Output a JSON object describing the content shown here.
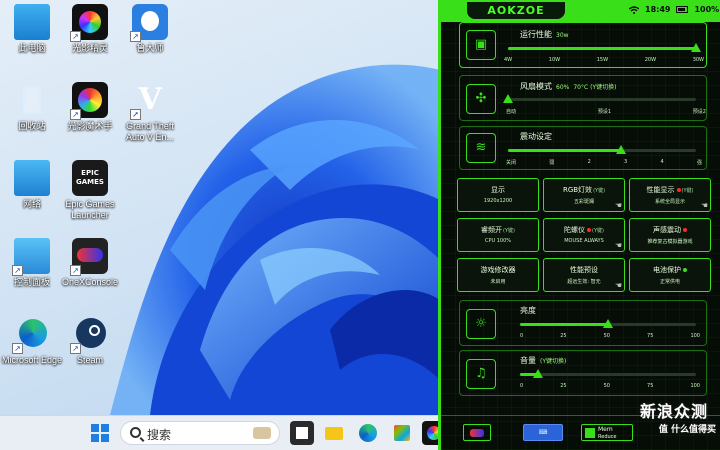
{
  "desktop": {
    "icons": [
      {
        "label": "此电脑"
      },
      {
        "label": "光影精灵"
      },
      {
        "label": "鲁大师"
      },
      {
        "label": "回收站"
      },
      {
        "label": "光影魔术手"
      },
      {
        "label": "Grand Theft Auto V En..."
      },
      {
        "label": "网络"
      },
      {
        "label": "Epic Games Launcher"
      },
      {
        "label": "控制面板"
      },
      {
        "label": "OneXConsole"
      },
      {
        "label": "Microsoft Edge"
      },
      {
        "label": "Steam"
      }
    ],
    "epic_logo_text": "EPIC GAMES"
  },
  "taskbar": {
    "search_placeholder": "搜索"
  },
  "panel": {
    "brand": "AOKZOE",
    "status": {
      "time": "18:49",
      "battery": "100%"
    },
    "performance": {
      "title": "运行性能",
      "value": "30w",
      "level_percent": 100,
      "ticks": [
        "4W",
        "10W",
        "15W",
        "20W",
        "30W"
      ]
    },
    "fan": {
      "title": "风扇模式",
      "value": "60%",
      "sub": "70°C (Y键切换)",
      "level_percent": 0,
      "ticks": [
        "自动",
        "预设1",
        "预设2"
      ]
    },
    "vibration": {
      "title": "震动设定",
      "level_percent": 60,
      "ticks": [
        "关闭",
        "弱",
        "2",
        "3",
        "4",
        "强"
      ]
    },
    "tiles": [
      {
        "title": "显示",
        "hint": "",
        "value": "1920x1200",
        "dot": ""
      },
      {
        "title": "RGB灯效",
        "hint": "(Y键)",
        "value": "五彩斑斓",
        "dot": ""
      },
      {
        "title": "性能显示",
        "hint": "(Y键)",
        "value": "系统全局显示",
        "dot": "#ff2a2a"
      },
      {
        "title": "睿频开",
        "hint": "(Y键)",
        "value": "CPU 100%",
        "dot": ""
      },
      {
        "title": "陀螺仪",
        "hint": "(Y键)",
        "value": "MOUSE ALWAYS",
        "dot": "#ff2a2a"
      },
      {
        "title": "声感震动",
        "hint": "",
        "value": "推荐复古模拟器游戏",
        "dot": "#ff2a2a"
      },
      {
        "title": "游戏修改器",
        "hint": "",
        "value": "未启用",
        "dot": ""
      },
      {
        "title": "性能预设",
        "hint": "",
        "value": "超远生效: 智无",
        "dot": ""
      },
      {
        "title": "电池保护",
        "hint": "",
        "value": "正常供电",
        "dot": "#39e01a"
      }
    ],
    "brightness": {
      "title": "亮度",
      "level_percent": 50,
      "ticks": [
        "0",
        "25",
        "50",
        "75",
        "100"
      ]
    },
    "volume": {
      "title": "音量",
      "sub": "(Y键切换)",
      "level_percent": 10,
      "ticks": [
        "0",
        "25",
        "50",
        "75",
        "100"
      ]
    },
    "bottom": {
      "mem_label": "Mem",
      "mem_sub": "Reduce"
    }
  },
  "watermark": {
    "line1": "新浪众测",
    "line2": "值 什么值得买"
  }
}
